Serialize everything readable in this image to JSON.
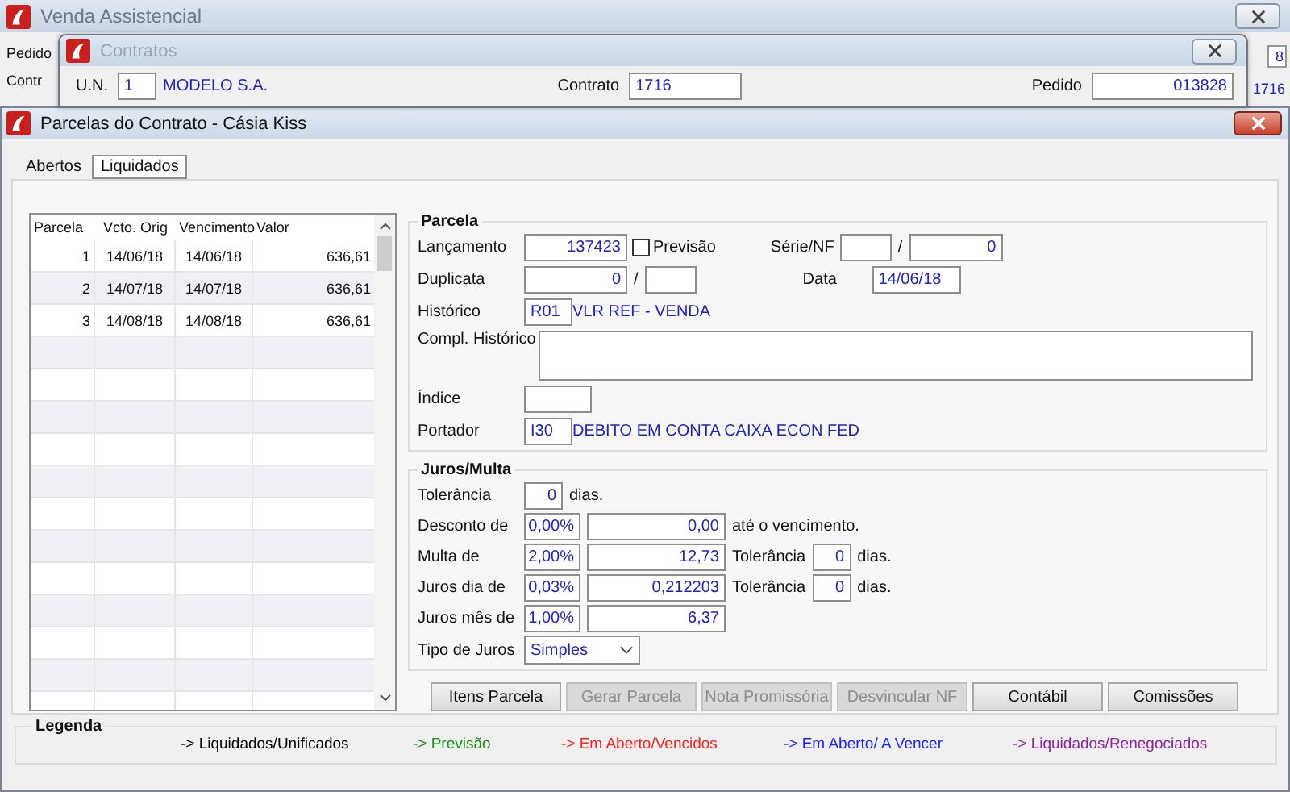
{
  "background_window": {
    "title": "Venda Assistencial",
    "labels": [
      "Pedido",
      "Contr"
    ],
    "values": [
      "8",
      "1716"
    ]
  },
  "contratos_window": {
    "title": "Contratos",
    "un": {
      "label": "U.N.",
      "value": "1",
      "name": "MODELO S.A."
    },
    "contrato": {
      "label": "Contrato",
      "value": "1716"
    },
    "pedido": {
      "label": "Pedido",
      "value": "013828"
    }
  },
  "window": {
    "title": "Parcelas do Contrato - Cásia Kiss"
  },
  "tabs": [
    {
      "label": "Abertos",
      "selected": false
    },
    {
      "label": "Liquidados",
      "selected": true
    }
  ],
  "table": {
    "columns": [
      "Parcela",
      "Vcto. Orig",
      "Vencimento",
      "Valor"
    ],
    "rows": [
      [
        "1",
        "14/06/18",
        "14/06/18",
        "636,61"
      ],
      [
        "2",
        "14/07/18",
        "14/07/18",
        "636,61"
      ],
      [
        "3",
        "14/08/18",
        "14/08/18",
        "636,61"
      ]
    ]
  },
  "parcela": {
    "title": "Parcela",
    "lancamento": {
      "label": "Lançamento",
      "value": "137423"
    },
    "previsao": {
      "label": "Previsão",
      "checked": false
    },
    "serie_nf": {
      "label": "Série/NF",
      "separator": "/",
      "number": "0"
    },
    "duplicata": {
      "label": "Duplicata",
      "value": "0",
      "separator": "/"
    },
    "data": {
      "label": "Data",
      "value": "14/06/18"
    },
    "historico": {
      "label": "Histórico",
      "code": "R01",
      "description": "VLR REF - VENDA"
    },
    "compl_historico": {
      "label": "Compl. Histórico"
    },
    "indice": {
      "label": "Índice"
    },
    "portador": {
      "label": "Portador",
      "code": "I30",
      "description": "DEBITO EM CONTA CAIXA ECON FED"
    }
  },
  "juros_multa": {
    "title": "Juros/Multa",
    "tolerancia": {
      "label": "Tolerância",
      "value": "0",
      "unit": "dias."
    },
    "rows": [
      {
        "label": "Desconto de",
        "percent": "0,00%",
        "amount": "0,00",
        "note": "até o vencimento."
      },
      {
        "label": "Multa de",
        "percent": "2,00%",
        "amount": "12,73",
        "tolerance_label": "Tolerância",
        "tolerance": "0",
        "unit": "dias."
      },
      {
        "label": "Juros dia de",
        "percent": "0,03%",
        "amount": "0,212203",
        "tolerance_label": "Tolerância",
        "tolerance": "0",
        "unit": "dias."
      },
      {
        "label": "Juros mês de",
        "percent": "1,00%",
        "amount": "6,37"
      }
    ],
    "tipo_juros": {
      "label": "Tipo de Juros",
      "value": "Simples"
    }
  },
  "buttons": [
    {
      "label": "Itens Parcela",
      "disabled": false
    },
    {
      "label": "Gerar Parcela",
      "disabled": true
    },
    {
      "label": "Nota Promissória",
      "disabled": true
    },
    {
      "label": "Desvincular NF",
      "disabled": true
    },
    {
      "label": "Contábil",
      "disabled": false
    },
    {
      "label": "Comissões",
      "disabled": false
    }
  ],
  "legend": {
    "title": "Legenda",
    "items": [
      {
        "label": "-> Liquidados/Unificados",
        "color": "#000000"
      },
      {
        "label": "-> Previsão",
        "color": "#1a8a1a"
      },
      {
        "label": "-> Em Aberto/Vencidos",
        "color": "#ff2020"
      },
      {
        "label": "-> Em Aberto/ A Vencer",
        "color": "#2020ff"
      },
      {
        "label": "-> Liquidados/Renegociados",
        "color": "#9020a0"
      }
    ]
  }
}
